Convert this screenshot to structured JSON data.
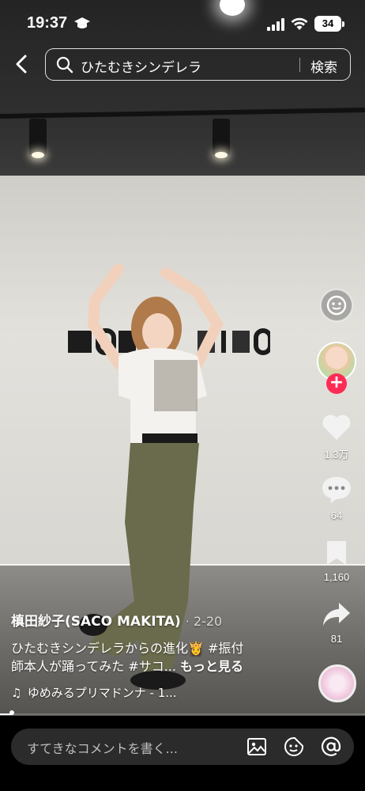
{
  "status_bar": {
    "time": "19:37",
    "battery": "34"
  },
  "search": {
    "query": "ひたむきシンデレラ",
    "button_label": "検索"
  },
  "actions": {
    "likes": "1.3万",
    "comments": "64",
    "saves": "1,160",
    "shares": "81"
  },
  "video": {
    "author": "槙田紗子(SACO MAKITA)",
    "date": "· 2-20",
    "caption_line1": "ひたむきシンデレラからの進化👸 #振付",
    "caption_line2": "師本人が踊ってみた #サコ...",
    "more_label": "もっと見る",
    "music": "ゆめみるプリマドンナ - 1...",
    "progress": 0.03
  },
  "comment_bar": {
    "placeholder": "すてきなコメントを書く..."
  }
}
